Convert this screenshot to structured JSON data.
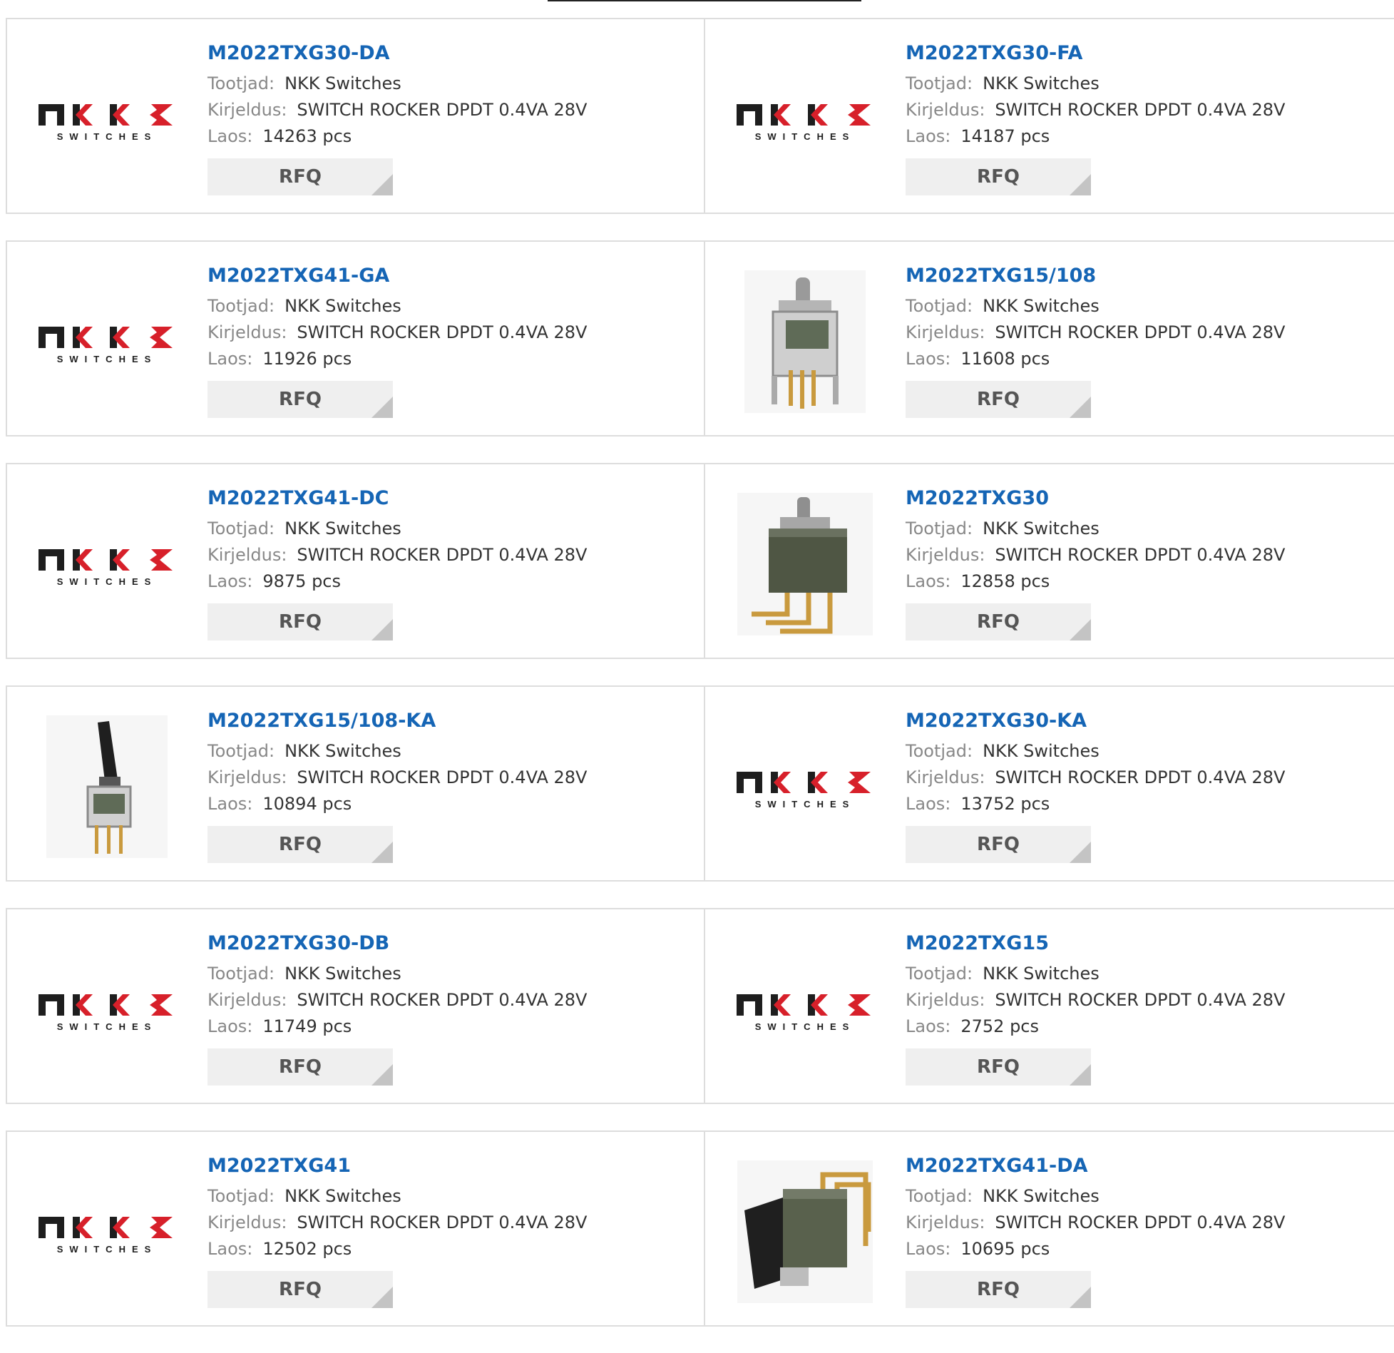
{
  "labels": {
    "manufacturer": "Tootjad:",
    "description": "Kirjeldus:",
    "stock": "Laos:",
    "rfq": "RFQ"
  },
  "logo_text": "SWITCHES",
  "products": [
    {
      "part": "M2022TXG30-DA",
      "manufacturer": "NKK Switches",
      "description": "SWITCH ROCKER DPDT 0.4VA 28V",
      "stock": "14263 pcs",
      "image": "nkk-logo"
    },
    {
      "part": "M2022TXG30-FA",
      "manufacturer": "NKK Switches",
      "description": "SWITCH ROCKER DPDT 0.4VA 28V",
      "stock": "14187 pcs",
      "image": "nkk-logo"
    },
    {
      "part": "M2022TXG41-GA",
      "manufacturer": "NKK Switches",
      "description": "SWITCH ROCKER DPDT 0.4VA 28V",
      "stock": "11926 pcs",
      "image": "nkk-logo"
    },
    {
      "part": "M2022TXG15/108",
      "manufacturer": "NKK Switches",
      "description": "SWITCH ROCKER DPDT 0.4VA 28V",
      "stock": "11608 pcs",
      "image": "toggle-switch-photo"
    },
    {
      "part": "M2022TXG41-DC",
      "manufacturer": "NKK Switches",
      "description": "SWITCH ROCKER DPDT 0.4VA 28V",
      "stock": "9875 pcs",
      "image": "nkk-logo"
    },
    {
      "part": "M2022TXG30",
      "manufacturer": "NKK Switches",
      "description": "SWITCH ROCKER DPDT 0.4VA 28V",
      "stock": "12858 pcs",
      "image": "right-angle-switch-photo"
    },
    {
      "part": "M2022TXG15/108-KA",
      "manufacturer": "NKK Switches",
      "description": "SWITCH ROCKER DPDT 0.4VA 28V",
      "stock": "10894 pcs",
      "image": "lever-switch-photo"
    },
    {
      "part": "M2022TXG30-KA",
      "manufacturer": "NKK Switches",
      "description": "SWITCH ROCKER DPDT 0.4VA 28V",
      "stock": "13752 pcs",
      "image": "nkk-logo"
    },
    {
      "part": "M2022TXG30-DB",
      "manufacturer": "NKK Switches",
      "description": "SWITCH ROCKER DPDT 0.4VA 28V",
      "stock": "11749 pcs",
      "image": "nkk-logo"
    },
    {
      "part": "M2022TXG15",
      "manufacturer": "NKK Switches",
      "description": "SWITCH ROCKER DPDT 0.4VA 28V",
      "stock": "2752 pcs",
      "image": "nkk-logo"
    },
    {
      "part": "M2022TXG41",
      "manufacturer": "NKK Switches",
      "description": "SWITCH ROCKER DPDT 0.4VA 28V",
      "stock": "12502 pcs",
      "image": "nkk-logo"
    },
    {
      "part": "M2022TXG41-DA",
      "manufacturer": "NKK Switches",
      "description": "SWITCH ROCKER DPDT 0.4VA 28V",
      "stock": "10695 pcs",
      "image": "rocker-switch-photo"
    }
  ],
  "colors": {
    "part_link": "#1565b5",
    "logo_red": "#d7202a",
    "logo_dark": "#1e1e1e"
  }
}
